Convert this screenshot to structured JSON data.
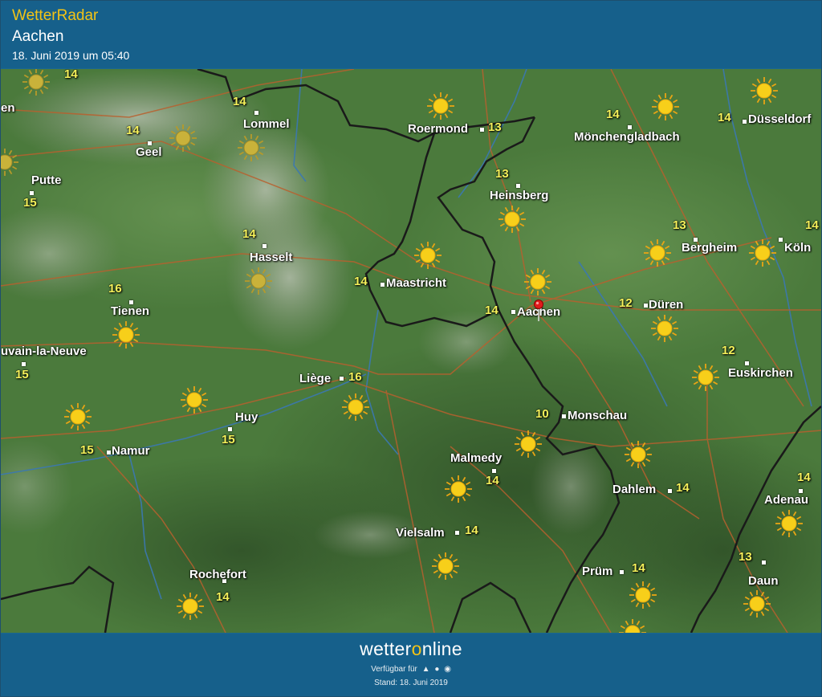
{
  "header": {
    "app_title": "WetterRadar",
    "location": "Aachen",
    "timestamp": "18. Juni 2019 um 05:40"
  },
  "map": {
    "selected_location": "Aachen",
    "cities": [
      {
        "name": "Lommel",
        "temp": "14"
      },
      {
        "name": "Geel",
        "temp": "14"
      },
      {
        "name": "Putte",
        "temp": "15"
      },
      {
        "name": "Roermond",
        "temp": "13"
      },
      {
        "name": "Mönchengladbach",
        "temp": "14"
      },
      {
        "name": "Düsseldorf",
        "temp": "14"
      },
      {
        "name": "Heinsberg",
        "temp": "13"
      },
      {
        "name": "Hasselt",
        "temp": "14"
      },
      {
        "name": "Maastricht",
        "temp": "14"
      },
      {
        "name": "Bergheim",
        "temp": "13"
      },
      {
        "name": "Köln",
        "temp": "14"
      },
      {
        "name": "Tienen",
        "temp": "16"
      },
      {
        "name": "Aachen",
        "temp": "14"
      },
      {
        "name": "Düren",
        "temp": "12"
      },
      {
        "name": "uvain-la-Neuve",
        "temp": "15"
      },
      {
        "name": "Liège",
        "temp": "16"
      },
      {
        "name": "Euskirchen",
        "temp": "12"
      },
      {
        "name": "Huy",
        "temp": "15"
      },
      {
        "name": "Monschau",
        "temp": "10"
      },
      {
        "name": "Namur",
        "temp": "15"
      },
      {
        "name": "Malmedy",
        "temp": "14"
      },
      {
        "name": "Dahlem",
        "temp": "14"
      },
      {
        "name": "Adenau",
        "temp": "14"
      },
      {
        "name": "Vielsalm",
        "temp": "14"
      },
      {
        "name": "Rochefort",
        "temp": "14"
      },
      {
        "name": "Prüm",
        "temp": "14"
      },
      {
        "name": "Daun",
        "temp": "13"
      },
      {
        "name": "en",
        "temp": ""
      }
    ],
    "extra_temps": [
      "14"
    ],
    "weather_icon": "sun-icon"
  },
  "footer": {
    "brand_left": "wetter",
    "brand_o": "o",
    "brand_right": "nline",
    "available_label": "Verfügbar für",
    "platform_icons": [
      "android-icon",
      "apple-icon",
      "web-icon"
    ],
    "stand": "Stand: 18. Juni 2019"
  }
}
